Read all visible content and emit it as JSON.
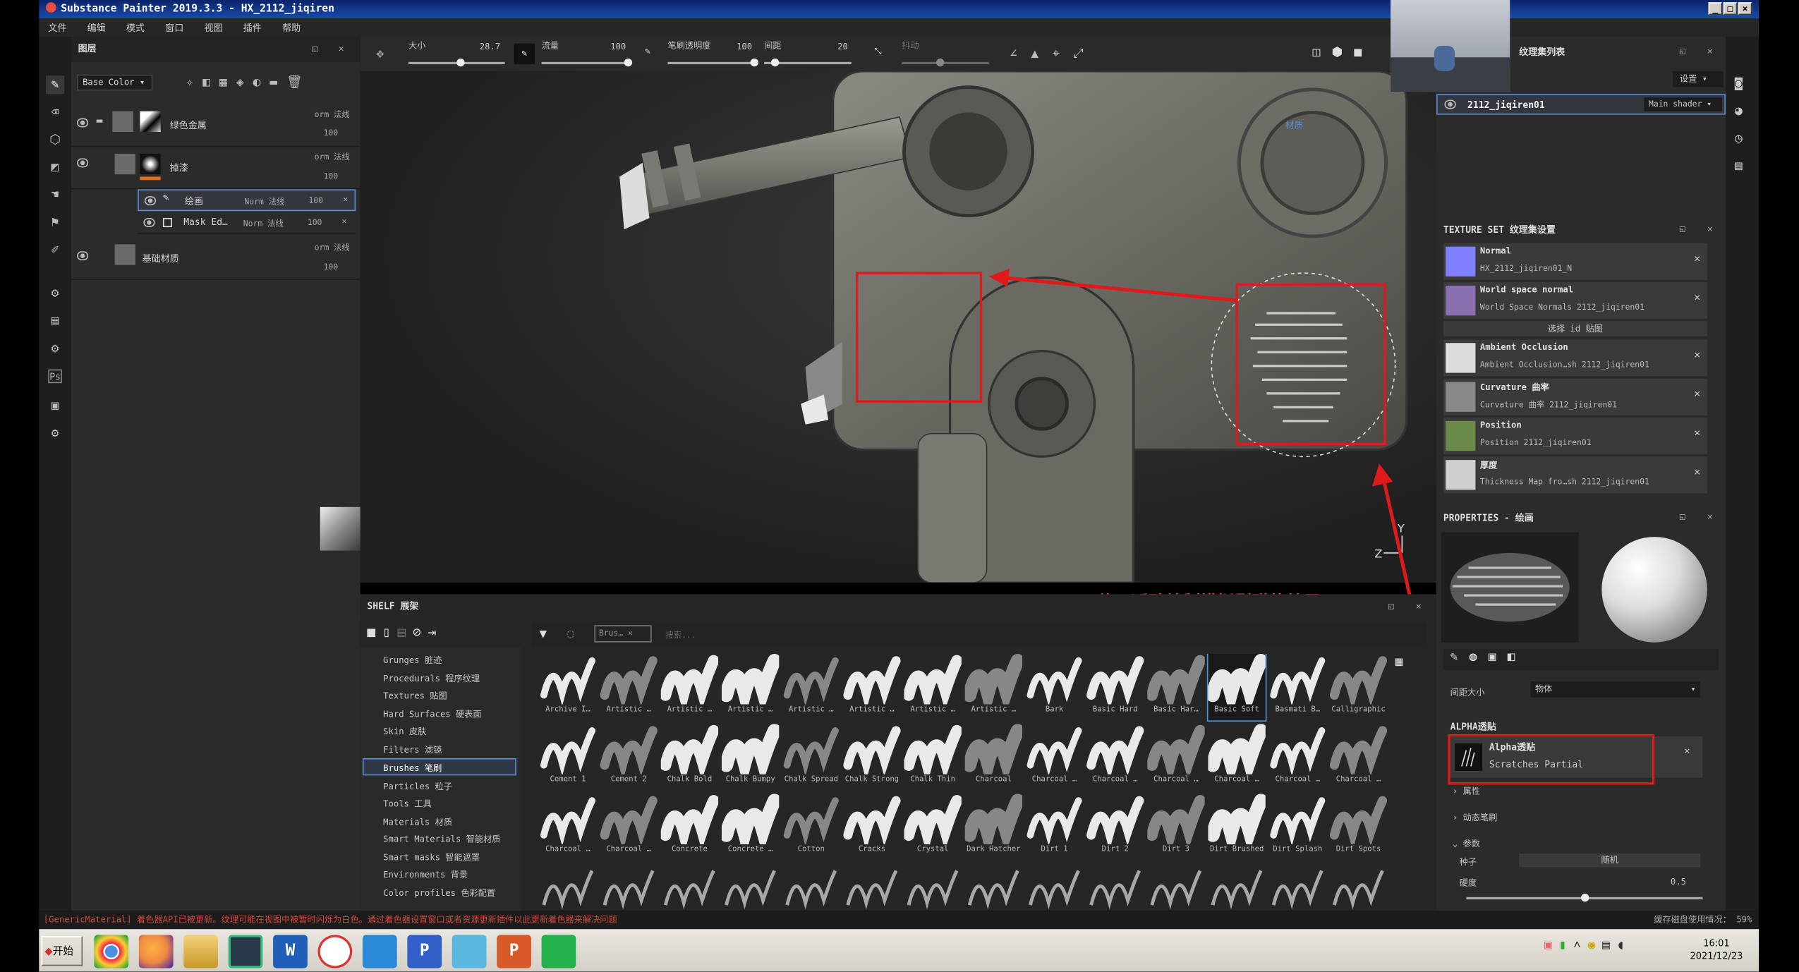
{
  "window": {
    "title": "Substance Painter 2019.3.3 - HX_2112_jiqiren",
    "buttons": [
      "_",
      "□",
      "×"
    ]
  },
  "menu": [
    "文件",
    "编辑",
    "模式",
    "窗口",
    "视图",
    "插件",
    "帮助"
  ],
  "layers_panel": {
    "title": "图层",
    "channel_select": "Base Color",
    "layers": [
      {
        "name": "绿色金属",
        "blend": "orm 法线",
        "opacity": "100"
      },
      {
        "name": "掉漆",
        "blend": "orm 法线",
        "opacity": "100"
      },
      {
        "name": "绘画",
        "blend": "Norm 法线",
        "opacity": "100"
      },
      {
        "name": "Mask Ed…",
        "blend": "Norm 法线",
        "opacity": "100"
      },
      {
        "name": "基础材质",
        "blend": "orm 法线",
        "opacity": "100"
      }
    ]
  },
  "tool_bar": {
    "size_label": "大小",
    "size_value": "28.7",
    "flow_label": "流量",
    "flow_value": "100",
    "stroke_opacity_label": "笔刷透明度",
    "stroke_opacity_value": "100",
    "spacing_label": "间距",
    "spacing_value": "20",
    "jitter_label": "抖动"
  },
  "viewport": {
    "material_label": "材质",
    "axis_y": "Y",
    "axis_z": "Z"
  },
  "annotation": {
    "text": "使用透贴绘制模拟剐蹭的效果"
  },
  "shelf": {
    "title": "SHELF 展架",
    "filter_tag": "Brus…",
    "search_placeholder": "搜索...",
    "categories": [
      "Grunges 脏迹",
      "Procedurals 程序纹理",
      "Textures 贴图",
      "Hard Surfaces 硬表面",
      "Skin 皮肤",
      "Filters 滤镜",
      "Brushes 笔刷",
      "Particles 粒子",
      "Tools 工具",
      "Materials 材质",
      "Smart Materials 智能材质",
      "Smart masks 智能遮罩",
      "Environments 背景",
      "Color profiles 色彩配置"
    ],
    "selected_category": "Brushes 笔刷",
    "brushes": [
      [
        "Archive I…",
        "Artistic …",
        "Artistic …",
        "Artistic …",
        "Artistic …",
        "Artistic …",
        "Artistic …",
        "Artistic …",
        "Bark",
        "Basic Hard",
        "Basic Har…",
        "Basic Soft",
        "Basmati B…",
        "Calligraphic"
      ],
      [
        "Cement 1",
        "Cement 2",
        "Chalk Bold",
        "Chalk Bumpy",
        "Chalk Spread",
        "Chalk Strong",
        "Chalk Thin",
        "Charcoal",
        "Charcoal …",
        "Charcoal …",
        "Charcoal …",
        "Charcoal …",
        "Charcoal …",
        "Charcoal …"
      ],
      [
        "Charcoal …",
        "Charcoal …",
        "Concrete",
        "Concrete …",
        "Cotton",
        "Cracks",
        "Crystal",
        "Dark Hatcher",
        "Dirt 1",
        "Dirt 2",
        "Dirt 3",
        "Dirt Brushed",
        "Dirt Splash",
        "Dirt Spots"
      ]
    ],
    "selected_brush": "Basic Soft"
  },
  "texture_set_list": {
    "title": "纹理集列表",
    "settings_btn": "设置",
    "item": "2112_jiqiren01",
    "shader": "Main shader"
  },
  "texture_set_settings": {
    "title": "TEXTURE SET 纹理集设置",
    "channels": [
      {
        "name": "Normal",
        "sub": "HX_2112_jiqiren01_N",
        "color": "#7f7fff"
      },
      {
        "name": "World space normal",
        "sub": "World Space Normals 2112_jiqiren01",
        "color": "#8a6fb0"
      },
      {
        "name": "Ambient Occlusion",
        "sub": "Ambient Occlusion…sh 2112_jiqiren01",
        "color": "#dddddd"
      },
      {
        "name": "Curvature 曲率",
        "sub": "Curvature 曲率 2112_jiqiren01",
        "color": "#888888"
      },
      {
        "name": "Position",
        "sub": "Position 2112_jiqiren01",
        "color": "#6a8a4a"
      },
      {
        "name": "厚度",
        "sub": "Thickness Map fro…sh 2112_jiqiren01",
        "color": "#cfcfcf"
      }
    ],
    "id_bake": "选择 id 贴图"
  },
  "properties": {
    "title": "PROPERTIES - 绘画",
    "spacing_label": "间距大小",
    "spacing_value": "物体",
    "alpha_section": "ALPHA透贴",
    "alpha_name": "Alpha透贴",
    "alpha_value": "Scratches Partial",
    "attr_section": "属性",
    "dynamics_section": "动态笔刷",
    "params_section": "参数",
    "seed_label": "种子",
    "seed_value": "随机",
    "hardness_label": "硬度",
    "hardness_value": "0.5"
  },
  "status": {
    "message": "[GenericMaterial] 着色器API已被更新。纹理可能在视图中被暂时闪烁为白色。通过着色器设置窗口或者资源更新插件以此更新着色器来解决问题",
    "cache": "缓存磁盘使用情况： 59%"
  },
  "taskbar": {
    "start": "开始",
    "time": "16:01",
    "date": "2021/12/23"
  },
  "colors": {
    "annotation": "#e01a1a",
    "accent": "#3a7bd5"
  }
}
